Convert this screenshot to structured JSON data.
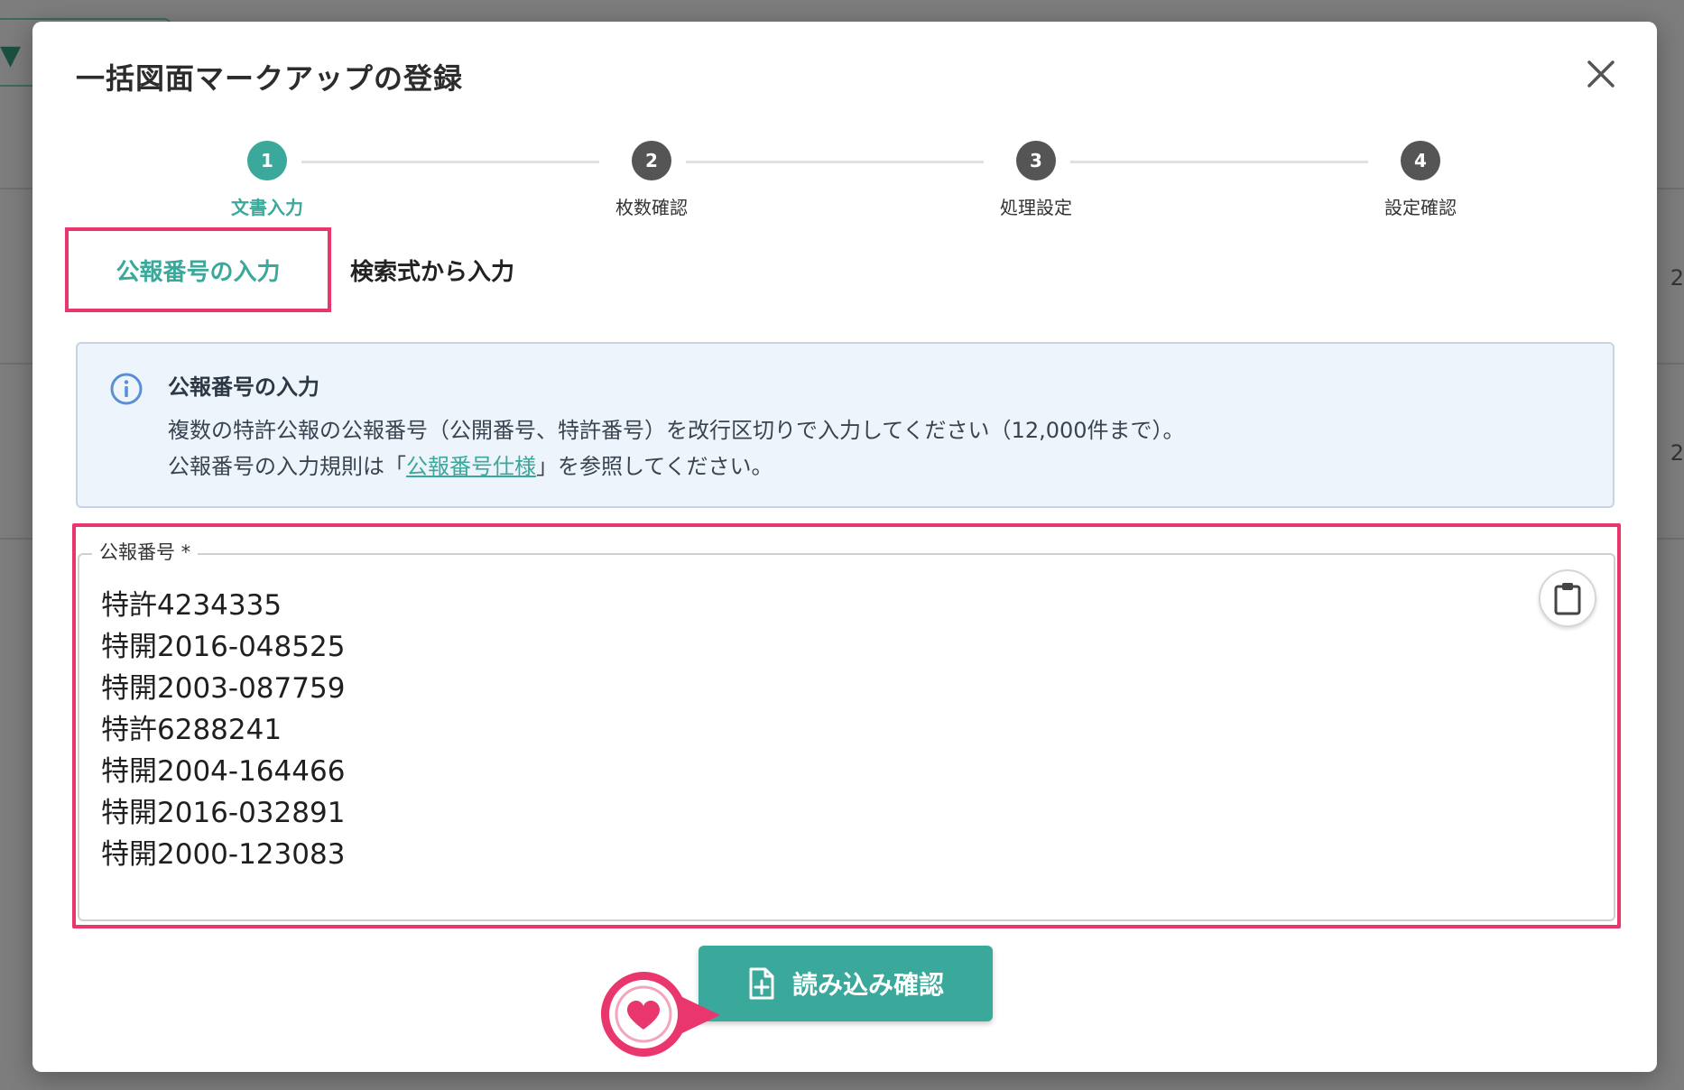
{
  "modal": {
    "title": "一括図面マークアップの登録"
  },
  "stepper": {
    "steps": [
      {
        "number": "1",
        "label": "文書入力"
      },
      {
        "number": "2",
        "label": "枚数確認"
      },
      {
        "number": "3",
        "label": "処理設定"
      },
      {
        "number": "4",
        "label": "設定確認"
      }
    ]
  },
  "tabs": {
    "publication_number": "公報番号の入力",
    "search_query": "検索式から入力"
  },
  "info": {
    "title": "公報番号の入力",
    "line1": "複数の特許公報の公報番号（公開番号、特許番号）を改行区切りで入力してください（12,000件まで）。",
    "line2_prefix": "公報番号の入力規則は「",
    "line2_link": "公報番号仕様",
    "line2_suffix": "」を参照してください。"
  },
  "field": {
    "label": "公報番号 *",
    "value": "特許4234335\n特開2016-048525\n特開2003-087759\n特許6288241\n特開2004-164466\n特開2016-032891\n特開2000-123083"
  },
  "actions": {
    "confirm_label": "読み込み確認"
  },
  "colors": {
    "accent": "#3aa89a",
    "highlight": "#e9376e",
    "info_bg": "#eef4fc"
  },
  "icons": {
    "close": "close-icon",
    "info": "info-icon",
    "paste": "clipboard-icon",
    "file_add": "file-plus-icon",
    "marker": "heart-icon"
  }
}
